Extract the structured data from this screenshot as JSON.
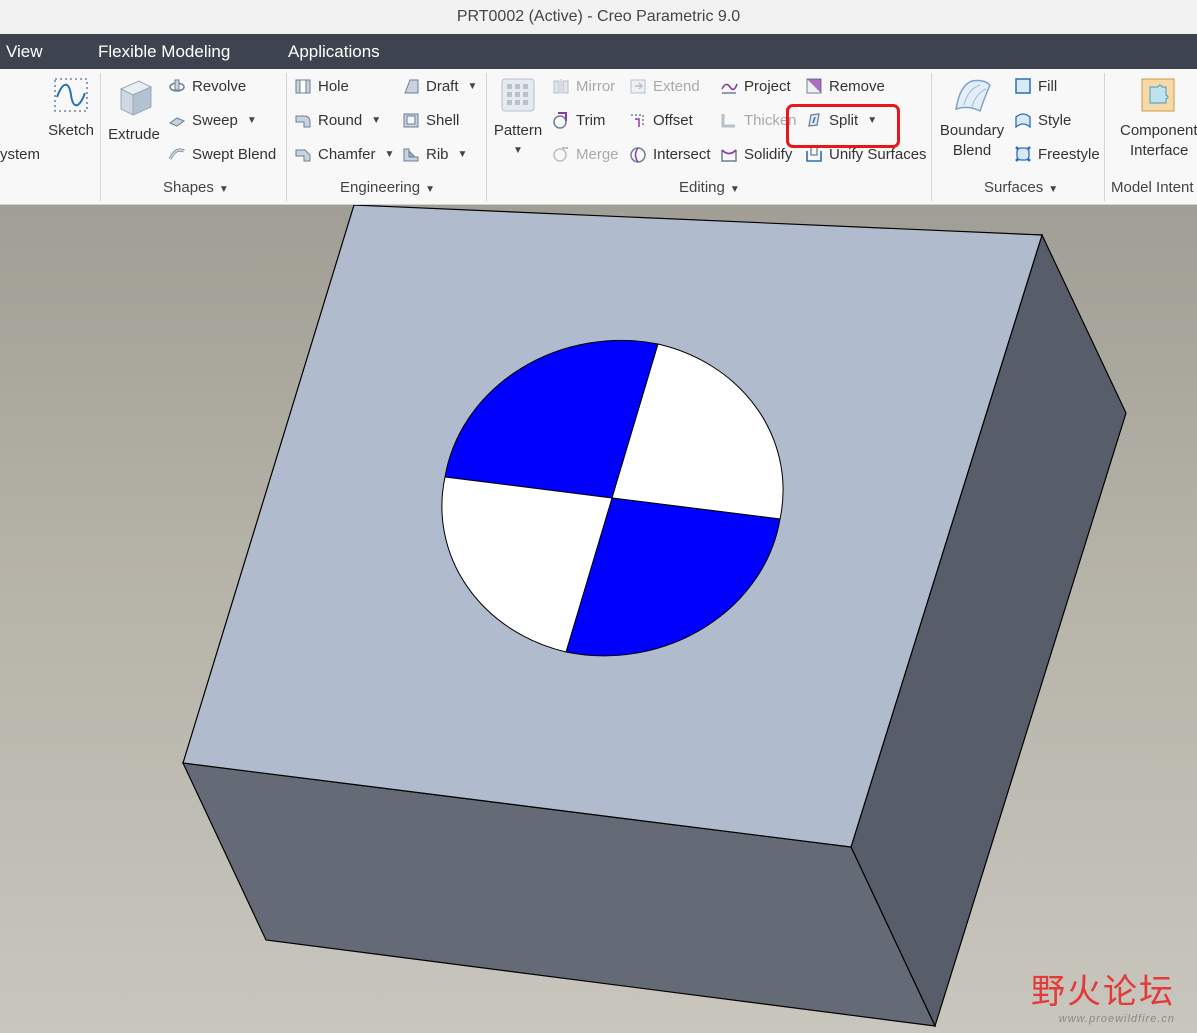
{
  "window": {
    "title": "PRT0002 (Active) - Creo Parametric 9.0"
  },
  "menu": {
    "items": [
      "View",
      "Flexible Modeling",
      "Applications"
    ]
  },
  "ribbon": {
    "datum": {
      "coord_system_partial": "ystem",
      "sketch": "Sketch"
    },
    "shapes": {
      "extrude": "Extrude",
      "revolve": "Revolve",
      "sweep": "Sweep",
      "swept_blend": "Swept Blend",
      "label": "Shapes"
    },
    "engineering": {
      "hole": "Hole",
      "round": "Round",
      "chamfer": "Chamfer",
      "draft": "Draft",
      "shell": "Shell",
      "rib": "Rib",
      "label": "Engineering"
    },
    "editing": {
      "pattern": "Pattern",
      "mirror": "Mirror",
      "trim": "Trim",
      "merge": "Merge",
      "extend": "Extend",
      "offset": "Offset",
      "intersect": "Intersect",
      "project": "Project",
      "thicken": "Thicken",
      "solidify": "Solidify",
      "remove": "Remove",
      "split": "Split",
      "unify_surfaces": "Unify Surfaces",
      "label": "Editing"
    },
    "surfaces": {
      "boundary_blend_1": "Boundary",
      "boundary_blend_2": "Blend",
      "fill": "Fill",
      "style": "Style",
      "freestyle": "Freestyle",
      "label": "Surfaces"
    },
    "model_intent": {
      "component_1": "Component",
      "component_2": "Interface",
      "label": "Model Intent"
    }
  },
  "model": {
    "top_face_color": "#b0bccd",
    "front_face_color": "#646b77",
    "right_face_color": "#585e69",
    "blue_quadrant_color": "#0000ff",
    "white_quadrant_color": "#ffffff"
  },
  "watermark": {
    "cn": "野火论坛",
    "url": "www.proewildfire.cn"
  }
}
